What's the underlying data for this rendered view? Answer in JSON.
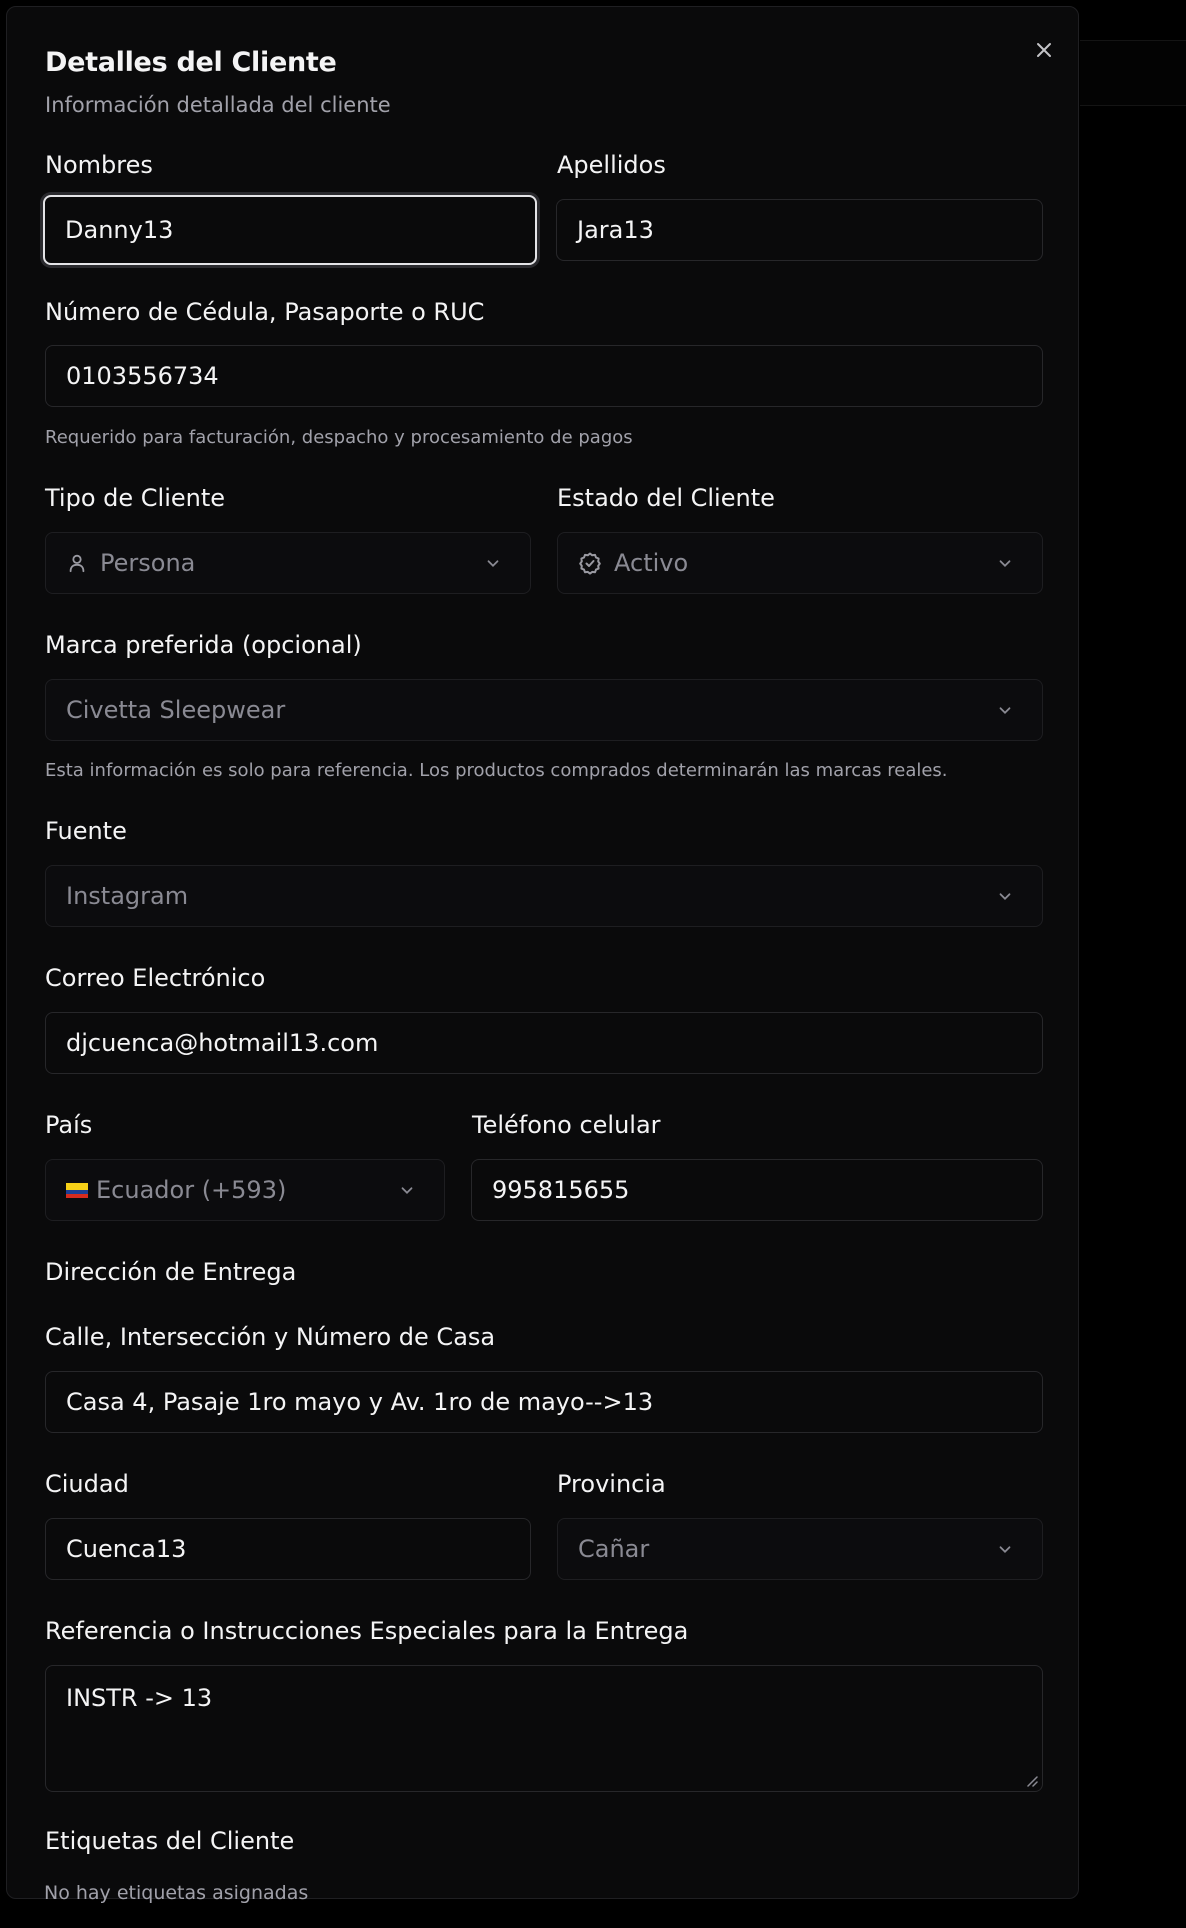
{
  "dialog": {
    "title": "Detalles del Cliente",
    "subtitle": "Información detallada del cliente"
  },
  "fields": {
    "nombres": {
      "label": "Nombres",
      "value": "Danny13"
    },
    "apellidos": {
      "label": "Apellidos",
      "value": "Jara13"
    },
    "cedula": {
      "label": "Número de Cédula, Pasaporte o RUC",
      "value": "0103556734",
      "help": "Requerido para facturación, despacho y procesamiento de pagos"
    },
    "tipo_cliente": {
      "label": "Tipo de Cliente",
      "value": "Persona",
      "icon": "user-icon"
    },
    "estado_cliente": {
      "label": "Estado del Cliente",
      "value": "Activo",
      "icon": "badge-check-icon"
    },
    "marca": {
      "label": "Marca preferida (opcional)",
      "value": "Civetta Sleepwear",
      "help": "Esta información es solo para referencia. Los productos comprados determinarán las marcas reales."
    },
    "fuente": {
      "label": "Fuente",
      "value": "Instagram"
    },
    "correo": {
      "label": "Correo Electrónico",
      "value": "djcuenca@hotmail13.com"
    },
    "pais": {
      "label": "País",
      "value": "Ecuador (+593)"
    },
    "telefono": {
      "label": "Teléfono celular",
      "value": "995815655"
    },
    "direccion_section": {
      "label": "Dirección de Entrega"
    },
    "calle": {
      "label": "Calle, Intersección y Número de Casa",
      "value": "Casa 4, Pasaje 1ro mayo y Av. 1ro de mayo-->13"
    },
    "ciudad": {
      "label": "Ciudad",
      "value": "Cuenca13"
    },
    "provincia": {
      "label": "Provincia",
      "value": "Cañar"
    },
    "referencia": {
      "label": "Referencia o Instrucciones Especiales para la Entrega",
      "value": "INSTR -> 13"
    },
    "etiquetas": {
      "label": "Etiquetas del Cliente",
      "empty": "No hay etiquetas asignadas"
    }
  },
  "colors": {
    "background": "#0a0a0b",
    "border": "#27272a",
    "text": "#f4f4f5",
    "muted": "#a1a1aa"
  }
}
